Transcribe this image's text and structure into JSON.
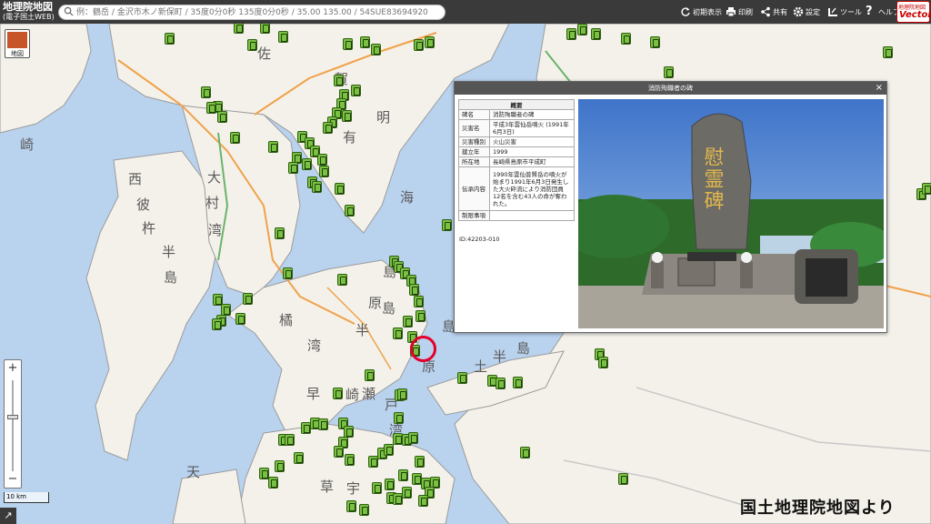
{
  "header": {
    "title": "地理院地図",
    "subtitle": "(電子国土WEB)",
    "search_placeholder": "例：鶴岳 / 金沢市木ノ新保町 / 35度0分0秒 135度0分0秒 / 35.00 135.00 / 54SUE83694920",
    "buttons": [
      {
        "label": "初期表示",
        "icon": "reload-icon"
      },
      {
        "label": "印刷",
        "icon": "print-icon"
      },
      {
        "label": "共有",
        "icon": "share-icon"
      },
      {
        "label": "設定",
        "icon": "gear-icon"
      },
      {
        "label": "ツール",
        "icon": "ruler-icon"
      },
      {
        "label": "ヘルプ",
        "icon": "help-icon"
      }
    ],
    "vector_logo_top": "地理院地図",
    "vector_logo_main": "Vector"
  },
  "layer_button_label": "地図",
  "zoom": {
    "plus": "+",
    "minus": "−"
  },
  "scale_label": "10 km",
  "map_labels": [
    "佐",
    "賀",
    "有",
    "明",
    "海",
    "崎",
    "西",
    "彼",
    "杵",
    "半",
    "島",
    "大",
    "村",
    "湾",
    "島",
    "原",
    "半",
    "橘",
    "湾",
    "島",
    "原",
    "島",
    "早",
    "崎",
    "瀬",
    "戸",
    "湾",
    "天",
    "草",
    "宇",
    "土",
    "半",
    "島"
  ],
  "popup": {
    "title": "消防殉職者の碑",
    "close": "×",
    "table_header": "概要",
    "rows": [
      {
        "key": "碑名",
        "value": "消防殉職者の碑"
      },
      {
        "key": "災害名",
        "value": "平成3年雲仙岳噴火 (1991年6月3日)"
      },
      {
        "key": "災害種別",
        "value": "火山災害"
      },
      {
        "key": "建立年",
        "value": "1999"
      },
      {
        "key": "所在地",
        "value": "長崎県島原市平成町"
      },
      {
        "key": "伝承内容",
        "value": "1990年雲仙普賢岳の噴火が始まり1991年6月3日発生した大火砕流により消防団員12名を含む43人の命が奪われた。"
      },
      {
        "key": "制限事項",
        "value": ""
      }
    ],
    "id": "ID:42203-010",
    "monument_text": "慰霊碑"
  },
  "credit": "国土地理院地図より",
  "colors": {
    "sea": "#b9d2ee",
    "land": "#f4f1ea",
    "marker": "#7ac143",
    "highlight": "#e4002b",
    "header": "#3a3a3a"
  },
  "marker_count": 175
}
